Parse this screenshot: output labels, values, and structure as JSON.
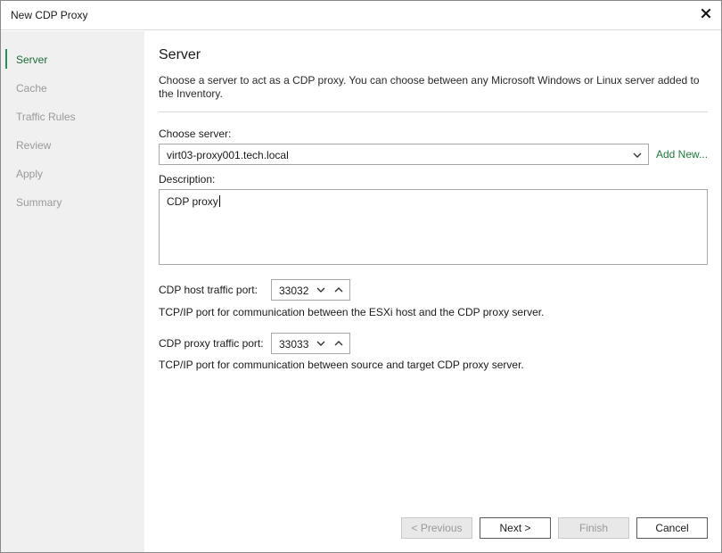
{
  "window": {
    "title": "New CDP Proxy"
  },
  "sidebar": {
    "steps": [
      {
        "label": "Server",
        "active": true
      },
      {
        "label": "Cache",
        "active": false
      },
      {
        "label": "Traffic Rules",
        "active": false
      },
      {
        "label": "Review",
        "active": false
      },
      {
        "label": "Apply",
        "active": false
      },
      {
        "label": "Summary",
        "active": false
      }
    ]
  },
  "main": {
    "heading": "Server",
    "description": "Choose a server to act as a CDP proxy. You can choose between any Microsoft Windows or Linux server added to the Inventory.",
    "choose_server": {
      "label": "Choose server:",
      "value": "virt03-proxy001.tech.local",
      "add_new_label": "Add New..."
    },
    "description_field": {
      "label": "Description:",
      "value": "CDP proxy"
    },
    "host_port": {
      "label": "CDP host traffic port:",
      "value": "33032",
      "hint": "TCP/IP port for communication between the ESXi host and the CDP proxy server."
    },
    "proxy_port": {
      "label": "CDP proxy traffic port:",
      "value": "33033",
      "hint": "TCP/IP port for communication between source and target CDP proxy server."
    }
  },
  "footer": {
    "previous_label": "< Previous",
    "next_label": "Next >",
    "finish_label": "Finish",
    "cancel_label": "Cancel"
  },
  "icons": {
    "close": "close-icon",
    "dropdown": "chevron-down-icon",
    "spin_down": "chevron-down-icon",
    "spin_up": "chevron-up-icon"
  },
  "colors": {
    "accent": "#2e8b57",
    "link": "#1e7a3c",
    "sidebar_bg": "#f0f0f0"
  }
}
